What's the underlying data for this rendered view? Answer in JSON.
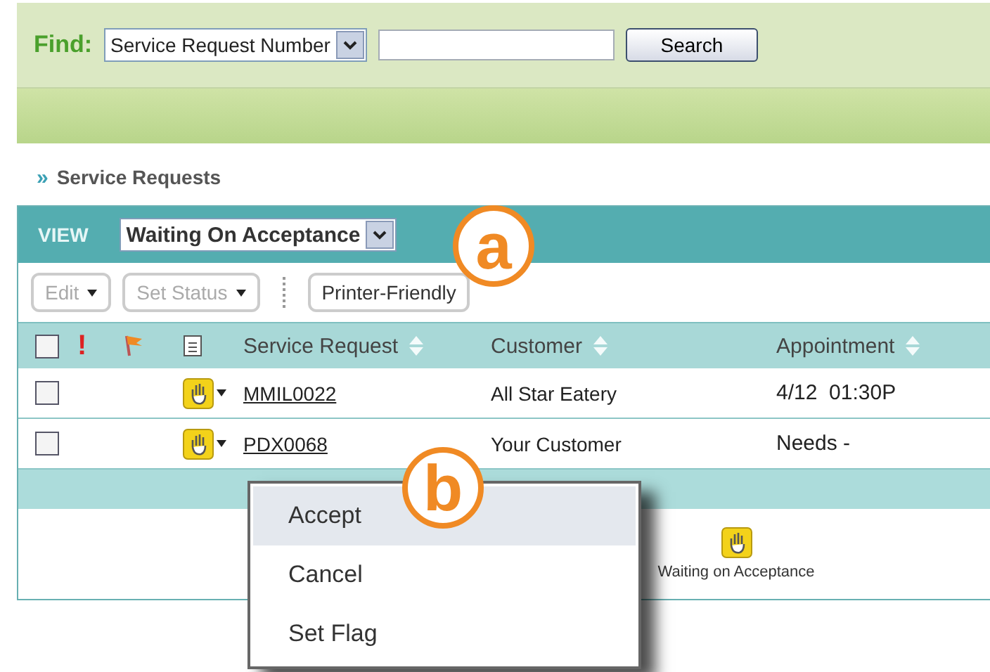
{
  "find": {
    "label": "Find:",
    "field_select": "Service Request Number",
    "search_button": "Search"
  },
  "breadcrumb": {
    "marker": "»",
    "label": "Service Requests"
  },
  "view": {
    "label": "VIEW",
    "select": "Waiting On Acceptance"
  },
  "toolbar": [
    {
      "label": "Edit",
      "kind": "dropdown",
      "disabled": true
    },
    {
      "label": "Set Status",
      "kind": "dropdown",
      "disabled": true
    },
    {
      "label": "Printer-Friendly",
      "kind": "button",
      "disabled": false
    }
  ],
  "table": {
    "all_checked": false,
    "columns": [
      {
        "kind": "checkbox"
      },
      {
        "kind": "priority",
        "label": "!"
      },
      {
        "kind": "flag"
      },
      {
        "kind": "notes"
      },
      {
        "kind": "sort",
        "label": "Service Request"
      },
      {
        "kind": "sort",
        "label": "Customer"
      },
      {
        "kind": "sort",
        "label": "Appointment"
      }
    ],
    "rows": [
      {
        "checked": false,
        "request": "MMIL0022",
        "customer": "All Star Eatery",
        "appointment": "4/12  01:30P"
      },
      {
        "checked": false,
        "request": "PDX0068",
        "customer": "Your Customer",
        "appointment": "Needs -"
      }
    ]
  },
  "legend": {
    "label": "Waiting on Acceptance"
  },
  "menu": [
    {
      "label": "Accept",
      "selected": true
    },
    {
      "label": "Cancel",
      "selected": false
    },
    {
      "label": "Set Flag",
      "selected": false
    }
  ],
  "callouts": [
    "a",
    "b"
  ]
}
